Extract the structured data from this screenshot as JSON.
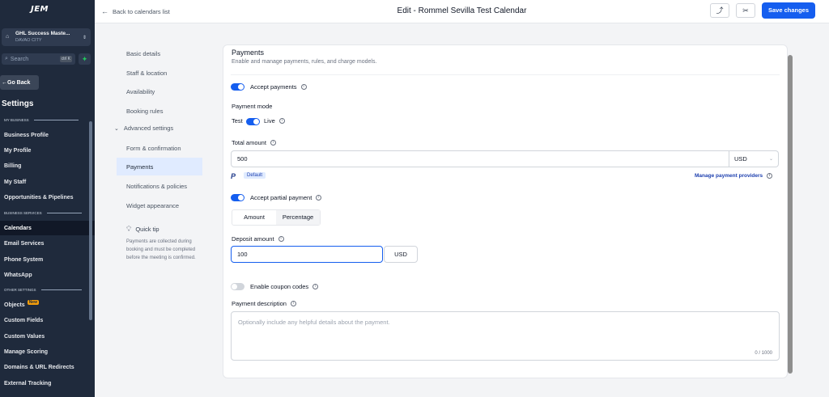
{
  "sidebar": {
    "logo": "JEM",
    "account": {
      "name": "GHL Success Maste...",
      "location": "DAVAO CITY"
    },
    "search": {
      "placeholder": "Search",
      "shortcut": "ctrl K"
    },
    "go_back": "Go Back",
    "title": "Settings",
    "sections": [
      {
        "heading": "MY BUSINESS",
        "items": [
          "Business Profile",
          "My Profile",
          "Billing",
          "My Staff",
          "Opportunities & Pipelines"
        ]
      },
      {
        "heading": "BUSINESS SERVICES",
        "items": [
          "Calendars",
          "Email Services",
          "Phone System",
          "WhatsApp"
        ]
      },
      {
        "heading": "OTHER SETTINGS",
        "items": [
          "Objects",
          "Custom Fields",
          "Custom Values",
          "Manage Scoring",
          "Domains & URL Redirects",
          "External Tracking"
        ]
      }
    ],
    "active_item": "Calendars",
    "new_badge": "New"
  },
  "topbar": {
    "back_label": "Back to calendars list",
    "title": "Edit - Rommel Sevilla Test Calendar",
    "save_label": "Save changes"
  },
  "subnav": {
    "items": [
      "Basic details",
      "Staff & location",
      "Availability",
      "Booking rules"
    ],
    "group_label": "Advanced settings",
    "group_items": [
      "Form & confirmation",
      "Payments",
      "Notifications & policies",
      "Widget appearance"
    ],
    "active": "Payments",
    "tip_title": "Quick tip",
    "tip_text": "Payments are collected during booking and must be completed before the meeting is confirmed."
  },
  "payments": {
    "title": "Payments",
    "subtitle": "Enable and manage payments, rules, and charge models.",
    "accept_payments_label": "Accept payments",
    "accept_payments": true,
    "payment_mode_label": "Payment mode",
    "mode_test": "Test",
    "mode_live": "Live",
    "live_mode": true,
    "total_amount_label": "Total amount",
    "total_amount": "500",
    "currency": "USD",
    "provider_badge": "Default",
    "manage_providers": "Manage payment providers",
    "partial_label": "Accept partial payment",
    "partial_enabled": true,
    "seg_amount": "Amount",
    "seg_percentage": "Percentage",
    "seg_selected": "Percentage",
    "deposit_label": "Deposit amount",
    "deposit_amount": "100",
    "deposit_currency": "USD",
    "coupon_label": "Enable coupon codes",
    "coupon_enabled": false,
    "description_label": "Payment description",
    "description_placeholder": "Optionally include any helpful details about the payment.",
    "description_counter": "0 / 1000"
  },
  "colors": {
    "accent": "#155eef",
    "sidebar_bg": "#1f2a3c",
    "active_nav": "#e0ebff"
  }
}
